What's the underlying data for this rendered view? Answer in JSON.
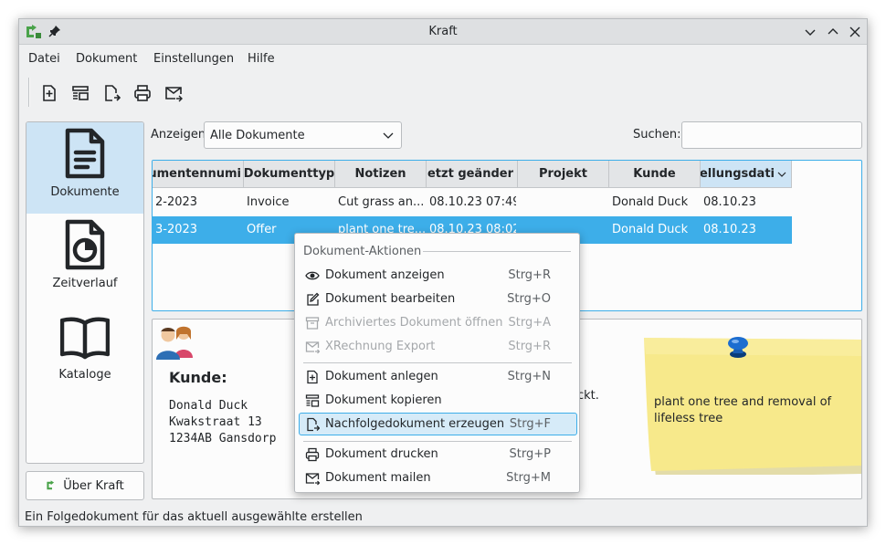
{
  "window": {
    "title": "Kraft"
  },
  "menu": [
    "Datei",
    "Dokument",
    "Einstellungen",
    "Hilfe"
  ],
  "toolbar": [
    "new-document-icon",
    "copy-document-icon",
    "follow-up-document-icon",
    "print-icon",
    "mail-icon"
  ],
  "sidebar": {
    "items": [
      {
        "label": "Dokumente",
        "icon": "document-icon",
        "active": true
      },
      {
        "label": "Zeitverlauf",
        "icon": "timeline-icon",
        "active": false
      },
      {
        "label": "Kataloge",
        "icon": "book-icon",
        "active": false
      }
    ],
    "about": "Über Kraft"
  },
  "filter": {
    "label": "Anzeigen",
    "value": "Alle Dokumente",
    "search_label": "Suchen:",
    "search_value": ""
  },
  "table": {
    "headers": [
      "umentennumi",
      "Dokumenttyp",
      "Notizen",
      "uletzt geänder",
      "Projekt",
      "Kunde",
      "tellungsdati"
    ],
    "rows": [
      [
        "2-2023",
        "Invoice",
        "Cut grass an...",
        "08.10.23 07:49",
        "",
        "Donald Duck",
        "08.10.23"
      ],
      [
        "3-2023",
        "Offer",
        "plant one tre...",
        "08.10.23 08:02",
        "",
        "Donald Duck",
        "08.10.23"
      ]
    ]
  },
  "detail": {
    "kunde_label": "Kunde:",
    "address": [
      "Donald Duck",
      "Kwakstraat 13",
      "1234AB Gansdorp"
    ],
    "clipped_text": "ckt.",
    "note": "plant one tree and removal of lifeless tree"
  },
  "context_menu": {
    "section": "Dokument-Aktionen",
    "items": [
      {
        "label": "Dokument anzeigen",
        "shortcut": "Strg+R",
        "icon": "eye-icon",
        "enabled": true
      },
      {
        "label": "Dokument bearbeiten",
        "shortcut": "Strg+O",
        "icon": "edit-icon",
        "enabled": true
      },
      {
        "label": "Archiviertes Dokument öffnen",
        "shortcut": "Strg+A",
        "icon": "archive-icon",
        "enabled": false
      },
      {
        "label": "XRechnung Export",
        "shortcut": "Strg+R",
        "icon": "mail-export-icon",
        "enabled": false
      },
      {
        "label": "Dokument anlegen",
        "shortcut": "Strg+N",
        "icon": "new-document-icon",
        "enabled": true
      },
      {
        "label": "Dokument kopieren",
        "shortcut": "",
        "icon": "copy-document-icon",
        "enabled": true
      },
      {
        "label": "Nachfolgedokument erzeugen",
        "shortcut": "Strg+F",
        "icon": "follow-up-document-icon",
        "enabled": true,
        "highlighted": true
      },
      {
        "label": "Dokument drucken",
        "shortcut": "Strg+P",
        "icon": "print-icon",
        "enabled": true
      },
      {
        "label": "Dokument mailen",
        "shortcut": "Strg+M",
        "icon": "mail-icon",
        "enabled": true
      }
    ]
  },
  "status": "Ein Folgedokument für das aktuell ausgewählte erstellen",
  "colors": {
    "accent": "#3daee9",
    "selection_bg": "#cde4f5",
    "window_bg": "#eff0f1",
    "note_yellow": "#f7e98b"
  }
}
